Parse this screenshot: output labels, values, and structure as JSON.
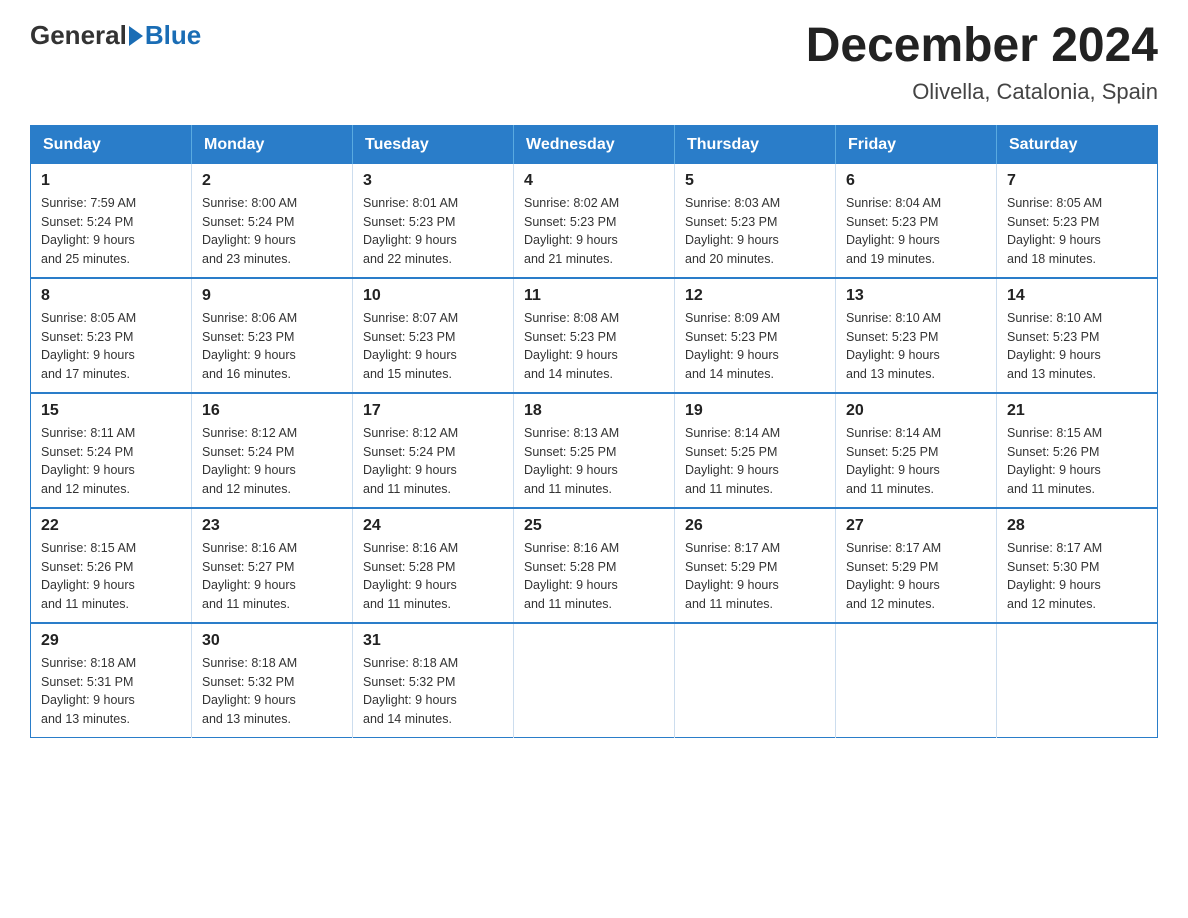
{
  "header": {
    "logo_general": "General",
    "logo_blue": "Blue",
    "title": "December 2024",
    "subtitle": "Olivella, Catalonia, Spain"
  },
  "calendar": {
    "weekdays": [
      "Sunday",
      "Monday",
      "Tuesday",
      "Wednesday",
      "Thursday",
      "Friday",
      "Saturday"
    ],
    "weeks": [
      [
        {
          "day": "1",
          "info": "Sunrise: 7:59 AM\nSunset: 5:24 PM\nDaylight: 9 hours\nand 25 minutes."
        },
        {
          "day": "2",
          "info": "Sunrise: 8:00 AM\nSunset: 5:24 PM\nDaylight: 9 hours\nand 23 minutes."
        },
        {
          "day": "3",
          "info": "Sunrise: 8:01 AM\nSunset: 5:23 PM\nDaylight: 9 hours\nand 22 minutes."
        },
        {
          "day": "4",
          "info": "Sunrise: 8:02 AM\nSunset: 5:23 PM\nDaylight: 9 hours\nand 21 minutes."
        },
        {
          "day": "5",
          "info": "Sunrise: 8:03 AM\nSunset: 5:23 PM\nDaylight: 9 hours\nand 20 minutes."
        },
        {
          "day": "6",
          "info": "Sunrise: 8:04 AM\nSunset: 5:23 PM\nDaylight: 9 hours\nand 19 minutes."
        },
        {
          "day": "7",
          "info": "Sunrise: 8:05 AM\nSunset: 5:23 PM\nDaylight: 9 hours\nand 18 minutes."
        }
      ],
      [
        {
          "day": "8",
          "info": "Sunrise: 8:05 AM\nSunset: 5:23 PM\nDaylight: 9 hours\nand 17 minutes."
        },
        {
          "day": "9",
          "info": "Sunrise: 8:06 AM\nSunset: 5:23 PM\nDaylight: 9 hours\nand 16 minutes."
        },
        {
          "day": "10",
          "info": "Sunrise: 8:07 AM\nSunset: 5:23 PM\nDaylight: 9 hours\nand 15 minutes."
        },
        {
          "day": "11",
          "info": "Sunrise: 8:08 AM\nSunset: 5:23 PM\nDaylight: 9 hours\nand 14 minutes."
        },
        {
          "day": "12",
          "info": "Sunrise: 8:09 AM\nSunset: 5:23 PM\nDaylight: 9 hours\nand 14 minutes."
        },
        {
          "day": "13",
          "info": "Sunrise: 8:10 AM\nSunset: 5:23 PM\nDaylight: 9 hours\nand 13 minutes."
        },
        {
          "day": "14",
          "info": "Sunrise: 8:10 AM\nSunset: 5:23 PM\nDaylight: 9 hours\nand 13 minutes."
        }
      ],
      [
        {
          "day": "15",
          "info": "Sunrise: 8:11 AM\nSunset: 5:24 PM\nDaylight: 9 hours\nand 12 minutes."
        },
        {
          "day": "16",
          "info": "Sunrise: 8:12 AM\nSunset: 5:24 PM\nDaylight: 9 hours\nand 12 minutes."
        },
        {
          "day": "17",
          "info": "Sunrise: 8:12 AM\nSunset: 5:24 PM\nDaylight: 9 hours\nand 11 minutes."
        },
        {
          "day": "18",
          "info": "Sunrise: 8:13 AM\nSunset: 5:25 PM\nDaylight: 9 hours\nand 11 minutes."
        },
        {
          "day": "19",
          "info": "Sunrise: 8:14 AM\nSunset: 5:25 PM\nDaylight: 9 hours\nand 11 minutes."
        },
        {
          "day": "20",
          "info": "Sunrise: 8:14 AM\nSunset: 5:25 PM\nDaylight: 9 hours\nand 11 minutes."
        },
        {
          "day": "21",
          "info": "Sunrise: 8:15 AM\nSunset: 5:26 PM\nDaylight: 9 hours\nand 11 minutes."
        }
      ],
      [
        {
          "day": "22",
          "info": "Sunrise: 8:15 AM\nSunset: 5:26 PM\nDaylight: 9 hours\nand 11 minutes."
        },
        {
          "day": "23",
          "info": "Sunrise: 8:16 AM\nSunset: 5:27 PM\nDaylight: 9 hours\nand 11 minutes."
        },
        {
          "day": "24",
          "info": "Sunrise: 8:16 AM\nSunset: 5:28 PM\nDaylight: 9 hours\nand 11 minutes."
        },
        {
          "day": "25",
          "info": "Sunrise: 8:16 AM\nSunset: 5:28 PM\nDaylight: 9 hours\nand 11 minutes."
        },
        {
          "day": "26",
          "info": "Sunrise: 8:17 AM\nSunset: 5:29 PM\nDaylight: 9 hours\nand 11 minutes."
        },
        {
          "day": "27",
          "info": "Sunrise: 8:17 AM\nSunset: 5:29 PM\nDaylight: 9 hours\nand 12 minutes."
        },
        {
          "day": "28",
          "info": "Sunrise: 8:17 AM\nSunset: 5:30 PM\nDaylight: 9 hours\nand 12 minutes."
        }
      ],
      [
        {
          "day": "29",
          "info": "Sunrise: 8:18 AM\nSunset: 5:31 PM\nDaylight: 9 hours\nand 13 minutes."
        },
        {
          "day": "30",
          "info": "Sunrise: 8:18 AM\nSunset: 5:32 PM\nDaylight: 9 hours\nand 13 minutes."
        },
        {
          "day": "31",
          "info": "Sunrise: 8:18 AM\nSunset: 5:32 PM\nDaylight: 9 hours\nand 14 minutes."
        },
        {
          "day": "",
          "info": ""
        },
        {
          "day": "",
          "info": ""
        },
        {
          "day": "",
          "info": ""
        },
        {
          "day": "",
          "info": ""
        }
      ]
    ]
  }
}
